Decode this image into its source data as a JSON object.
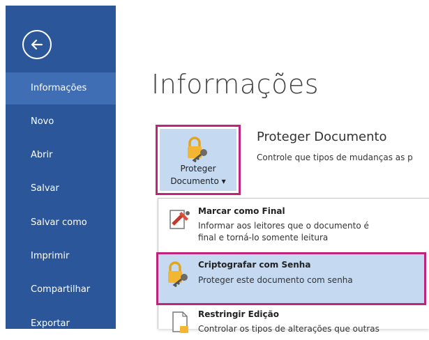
{
  "sidebar": {
    "back_label": "Voltar",
    "items": [
      {
        "label": "Informações"
      },
      {
        "label": "Novo"
      },
      {
        "label": "Abrir"
      },
      {
        "label": "Salvar"
      },
      {
        "label": "Salvar como"
      },
      {
        "label": "Imprimir"
      },
      {
        "label": "Compartilhar"
      },
      {
        "label": "Exportar"
      }
    ],
    "color": "#2b579a",
    "active_color": "#3f6eb5"
  },
  "main": {
    "title": "Informações",
    "protect_button": {
      "line1": "Proteger",
      "line2": "Documento ▾"
    },
    "section_title": "Proteger Documento",
    "section_desc": "Controle que tipos de mudanças as p"
  },
  "menu": {
    "items": [
      {
        "title": "Marcar como Final",
        "desc1": "Informar aos leitores que o documento é",
        "desc2": "final e torná-lo somente leitura",
        "icon": "mark-final-icon"
      },
      {
        "title": "Criptografar com Senha",
        "desc1": "Proteger este documento com senha",
        "icon": "lock-key-icon"
      },
      {
        "title": "Restringir Edição",
        "desc1": "Controlar os tipos de alterações que outras",
        "icon": "restrict-editing-icon"
      }
    ]
  },
  "highlight_color": "#c0237a"
}
